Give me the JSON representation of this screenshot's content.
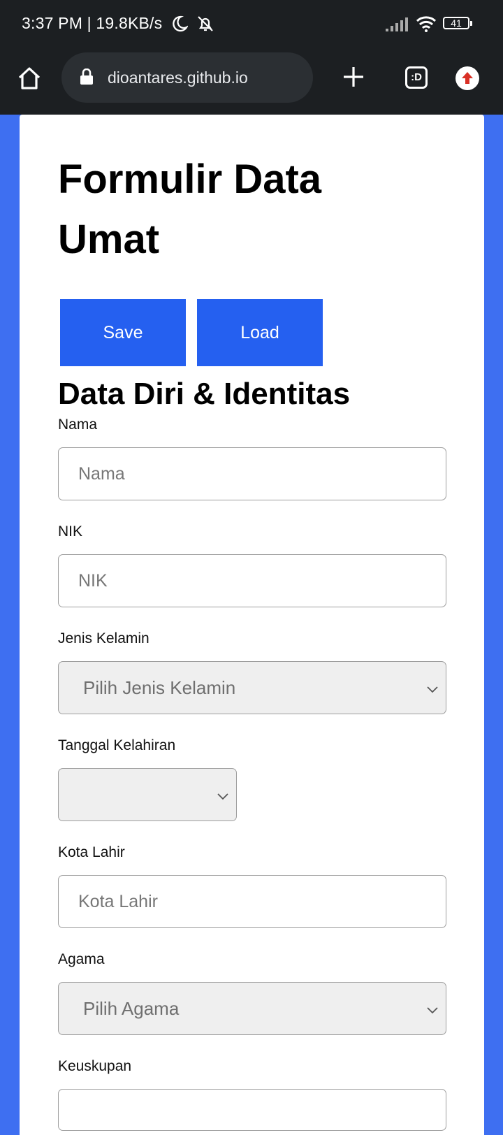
{
  "status_bar": {
    "time_speed": "3:37 PM | 19.8KB/s",
    "battery": "41"
  },
  "browser": {
    "url": "dioantares.github.io",
    "tab_label": ":D"
  },
  "form": {
    "title": "Formulir Data Umat",
    "save_label": "Save",
    "load_label": "Load",
    "section_title": "Data Diri & Identitas",
    "fields": {
      "nama": {
        "label": "Nama",
        "placeholder": "Nama"
      },
      "nik": {
        "label": "NIK",
        "placeholder": "NIK"
      },
      "jenis_kelamin": {
        "label": "Jenis Kelamin",
        "value": "Pilih Jenis Kelamin"
      },
      "tanggal_kelahiran": {
        "label": "Tanggal Kelahiran",
        "value": ""
      },
      "kota_lahir": {
        "label": "Kota Lahir",
        "placeholder": "Kota Lahir"
      },
      "agama": {
        "label": "Agama",
        "value": "Pilih Agama"
      },
      "keuskupan": {
        "label": "Keuskupan"
      }
    }
  },
  "colors": {
    "background": "#3e6ff1",
    "button": "#2560f0",
    "bar": "#1c1f22"
  }
}
